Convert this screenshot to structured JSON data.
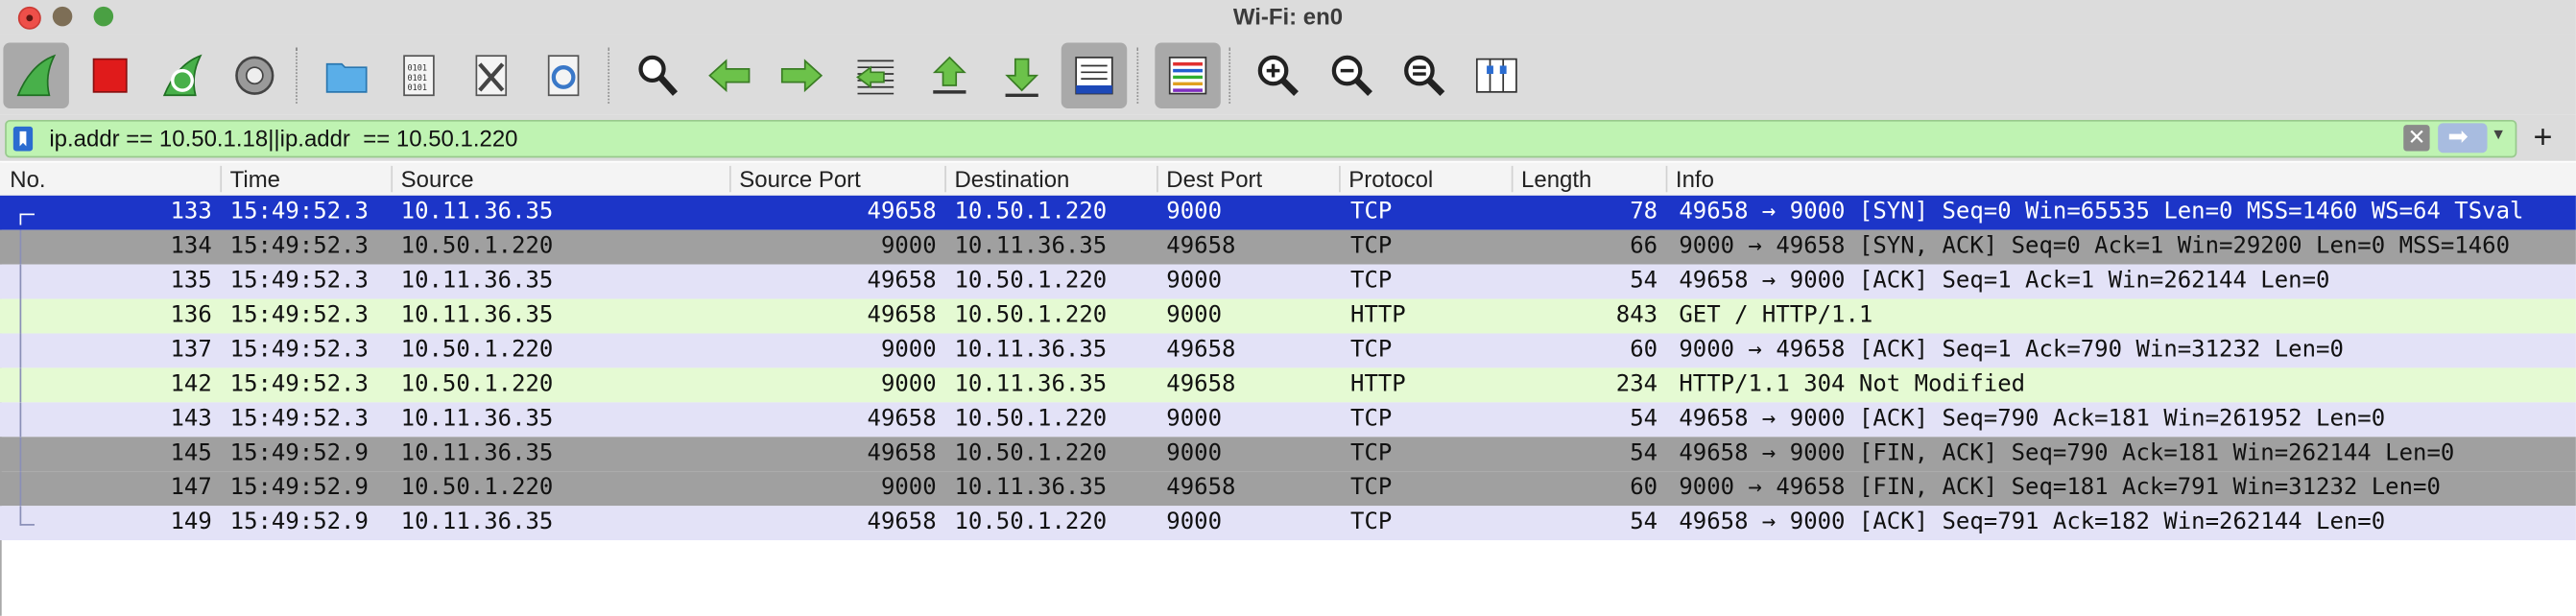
{
  "window": {
    "title": "Wi-Fi: en0"
  },
  "toolbar": {
    "icons": [
      "start-capture-icon",
      "stop-capture-icon",
      "restart-capture-icon",
      "capture-options-icon",
      "open-file-icon",
      "save-file-icon",
      "close-file-icon",
      "reload-file-icon",
      "find-packet-icon",
      "go-back-icon",
      "go-forward-icon",
      "go-to-packet-icon",
      "first-packet-icon",
      "last-packet-icon",
      "auto-scroll-icon",
      "colorize-icon",
      "zoom-in-icon",
      "zoom-out-icon",
      "normal-size-icon",
      "resize-columns-icon"
    ]
  },
  "filter": {
    "value": "ip.addr == 10.50.1.18||ip.addr  == 10.50.1.220",
    "clear_label": "✕",
    "add_label": "+"
  },
  "columns": [
    "No.",
    "Time",
    "Source",
    "Source Port",
    "Destination",
    "Dest Port",
    "Protocol",
    "Length",
    "Info"
  ],
  "packets": [
    {
      "no": "133",
      "time": "15:49:52.3",
      "src": "10.11.36.35",
      "sport": "49658",
      "dst": "10.50.1.220",
      "dport": "9000",
      "proto": "TCP",
      "len": "78",
      "info": "49658 → 9000 [SYN] Seq=0 Win=65535 Len=0 MSS=1460 WS=64 TSval"
    },
    {
      "no": "134",
      "time": "15:49:52.3",
      "src": "10.50.1.220",
      "sport": "9000",
      "dst": "10.11.36.35",
      "dport": "49658",
      "proto": "TCP",
      "len": "66",
      "info": "9000 → 49658 [SYN, ACK] Seq=0 Ack=1 Win=29200 Len=0 MSS=1460"
    },
    {
      "no": "135",
      "time": "15:49:52.3",
      "src": "10.11.36.35",
      "sport": "49658",
      "dst": "10.50.1.220",
      "dport": "9000",
      "proto": "TCP",
      "len": "54",
      "info": "49658 → 9000 [ACK] Seq=1 Ack=1 Win=262144 Len=0"
    },
    {
      "no": "136",
      "time": "15:49:52.3",
      "src": "10.11.36.35",
      "sport": "49658",
      "dst": "10.50.1.220",
      "dport": "9000",
      "proto": "HTTP",
      "len": "843",
      "info": "GET / HTTP/1.1"
    },
    {
      "no": "137",
      "time": "15:49:52.3",
      "src": "10.50.1.220",
      "sport": "9000",
      "dst": "10.11.36.35",
      "dport": "49658",
      "proto": "TCP",
      "len": "60",
      "info": "9000 → 49658 [ACK] Seq=1 Ack=790 Win=31232 Len=0"
    },
    {
      "no": "142",
      "time": "15:49:52.3",
      "src": "10.50.1.220",
      "sport": "9000",
      "dst": "10.11.36.35",
      "dport": "49658",
      "proto": "HTTP",
      "len": "234",
      "info": "HTTP/1.1 304 Not Modified"
    },
    {
      "no": "143",
      "time": "15:49:52.3",
      "src": "10.11.36.35",
      "sport": "49658",
      "dst": "10.50.1.220",
      "dport": "9000",
      "proto": "TCP",
      "len": "54",
      "info": "49658 → 9000 [ACK] Seq=790 Ack=181 Win=261952 Len=0"
    },
    {
      "no": "145",
      "time": "15:49:52.9",
      "src": "10.11.36.35",
      "sport": "49658",
      "dst": "10.50.1.220",
      "dport": "9000",
      "proto": "TCP",
      "len": "54",
      "info": "49658 → 9000 [FIN, ACK] Seq=790 Ack=181 Win=262144 Len=0"
    },
    {
      "no": "147",
      "time": "15:49:52.9",
      "src": "10.50.1.220",
      "sport": "9000",
      "dst": "10.11.36.35",
      "dport": "49658",
      "proto": "TCP",
      "len": "60",
      "info": "9000 → 49658 [FIN, ACK] Seq=181 Ack=791 Win=31232 Len=0"
    },
    {
      "no": "149",
      "time": "15:49:52.9",
      "src": "10.11.36.35",
      "sport": "49658",
      "dst": "10.50.1.220",
      "dport": "9000",
      "proto": "TCP",
      "len": "54",
      "info": "49658 → 9000 [ACK] Seq=791 Ack=182 Win=262144 Len=0"
    }
  ],
  "row_styles": [
    "selected",
    "fin",
    "tcp",
    "http",
    "tcp",
    "http",
    "tcp",
    "fin",
    "fin",
    "tcp"
  ],
  "colors": {
    "selected": "#1c35c8",
    "tcp": "#e3e2f7",
    "http": "#e5fad3",
    "fin": "#a0a0a0",
    "filter_bg": "#bff3b2"
  }
}
